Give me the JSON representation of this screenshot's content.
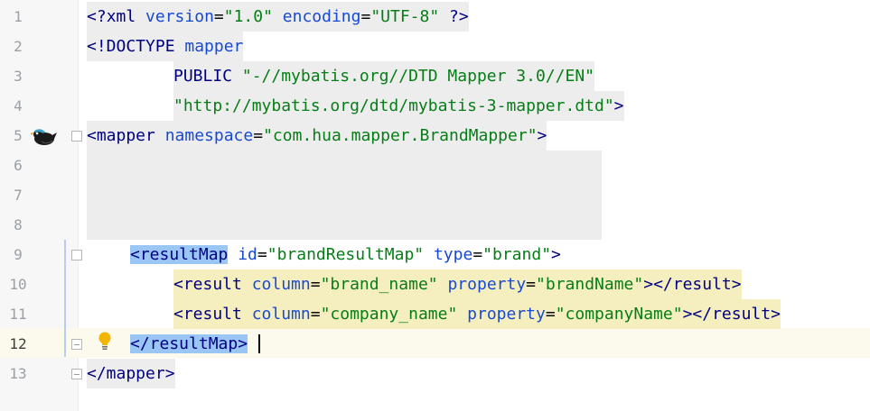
{
  "lines": [
    {
      "n": "1",
      "segments": [
        {
          "t": "<?",
          "c": "tag"
        },
        {
          "t": "xml ",
          "c": "tag"
        },
        {
          "t": "version",
          "c": "attr"
        },
        {
          "t": "=",
          "c": ""
        },
        {
          "t": "\"1.0\"",
          "c": "str"
        },
        {
          "t": " ",
          "c": ""
        },
        {
          "t": "encoding",
          "c": "attr"
        },
        {
          "t": "=",
          "c": ""
        },
        {
          "t": "\"UTF-8\"",
          "c": "str"
        },
        {
          "t": " ?>",
          "c": "tag"
        }
      ]
    },
    {
      "n": "2",
      "segments": [
        {
          "t": "<!DOCTYPE ",
          "c": "kw"
        },
        {
          "t": "mapper",
          "c": "attr"
        }
      ]
    },
    {
      "n": "3",
      "segments": [
        {
          "t": "PUBLIC ",
          "c": "kw"
        },
        {
          "t": "\"-//mybatis.org//DTD Mapper 3.0//EN\"",
          "c": "str"
        }
      ]
    },
    {
      "n": "4",
      "segments": [
        {
          "t": "\"http://mybatis.org/dtd/mybatis-3-mapper.dtd\"",
          "c": "str"
        },
        {
          "t": ">",
          "c": "kw"
        }
      ]
    },
    {
      "n": "5",
      "segments": [
        {
          "t": "<mapper ",
          "c": "tag"
        },
        {
          "t": "namespace",
          "c": "attr"
        },
        {
          "t": "=",
          "c": ""
        },
        {
          "t": "\"com.hua.mapper.BrandMapper\"",
          "c": "str"
        },
        {
          "t": ">",
          "c": "tag"
        }
      ]
    },
    {
      "n": "6",
      "segments": []
    },
    {
      "n": "7",
      "segments": []
    },
    {
      "n": "8",
      "segments": []
    },
    {
      "n": "9",
      "segments": [
        {
          "t": "<resultMap",
          "c": "tag"
        },
        {
          "t": " id",
          "c": "attr"
        },
        {
          "t": "=",
          "c": ""
        },
        {
          "t": "\"brandResultMap\"",
          "c": "str"
        },
        {
          "t": " ",
          "c": ""
        },
        {
          "t": "type",
          "c": "attr"
        },
        {
          "t": "=",
          "c": ""
        },
        {
          "t": "\"brand\"",
          "c": "str"
        },
        {
          "t": ">",
          "c": "tag"
        }
      ]
    },
    {
      "n": "10",
      "segments": [
        {
          "t": "<result ",
          "c": "tag"
        },
        {
          "t": "column",
          "c": "attr"
        },
        {
          "t": "=",
          "c": ""
        },
        {
          "t": "\"brand_name\"",
          "c": "str"
        },
        {
          "t": " ",
          "c": ""
        },
        {
          "t": "property",
          "c": "attr"
        },
        {
          "t": "=",
          "c": ""
        },
        {
          "t": "\"brandName\"",
          "c": "str"
        },
        {
          "t": "></result>",
          "c": "tag"
        }
      ]
    },
    {
      "n": "11",
      "segments": [
        {
          "t": "<result ",
          "c": "tag"
        },
        {
          "t": "column",
          "c": "attr"
        },
        {
          "t": "=",
          "c": ""
        },
        {
          "t": "\"company_name\"",
          "c": "str"
        },
        {
          "t": " ",
          "c": ""
        },
        {
          "t": "property",
          "c": "attr"
        },
        {
          "t": "=",
          "c": ""
        },
        {
          "t": "\"companyName\"",
          "c": "str"
        },
        {
          "t": "></result>",
          "c": "tag"
        }
      ]
    },
    {
      "n": "12",
      "segments": [
        {
          "t": "</resultMap>",
          "c": "tag"
        }
      ]
    },
    {
      "n": "13",
      "segments": [
        {
          "t": "</mapper>",
          "c": "tag"
        }
      ]
    }
  ],
  "colors": {
    "tag": "#000080",
    "attr": "#174ad4",
    "string": "#067d17",
    "highlight": "#ededed",
    "match": "#9ac6f5",
    "warn": "#f5eebf"
  },
  "icons": {
    "gutter_line5": "mybatis-bird-icon",
    "gutter_line12": "lightbulb-icon"
  }
}
